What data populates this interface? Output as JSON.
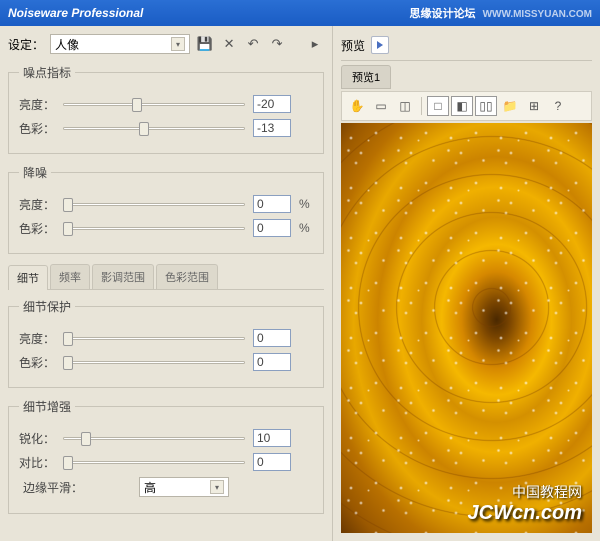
{
  "titlebar": {
    "app": "Noiseware Professional",
    "forum": "思缘设计论坛",
    "url": "WWW.MISSYUAN.COM"
  },
  "settings": {
    "label": "设定：",
    "preset": "人像"
  },
  "noiseIndex": {
    "legend": "噪点指标",
    "brightness": {
      "label": "亮度：",
      "value": "-20"
    },
    "color": {
      "label": "色彩：",
      "value": "-13"
    }
  },
  "denoise": {
    "legend": "降噪",
    "brightness": {
      "label": "亮度：",
      "value": "0",
      "unit": "%"
    },
    "color": {
      "label": "色彩：",
      "value": "0",
      "unit": "%"
    }
  },
  "tabs": {
    "detail": "细节",
    "freq": "频率",
    "tone": "影调范围",
    "colorRange": "色彩范围"
  },
  "detailProtect": {
    "legend": "细节保护",
    "brightness": {
      "label": "亮度：",
      "value": "0"
    },
    "color": {
      "label": "色彩：",
      "value": "0"
    }
  },
  "detailEnhance": {
    "legend": "细节增强",
    "sharpen": {
      "label": "锐化：",
      "value": "10"
    },
    "contrast": {
      "label": "对比：",
      "value": "0"
    },
    "edgeSmooth": {
      "label": "边缘平滑：",
      "value": "高"
    }
  },
  "preview": {
    "label": "预览",
    "tab1": "预览1"
  },
  "watermark": {
    "cn": "中国教程网",
    "en": "JCWcn.com"
  }
}
